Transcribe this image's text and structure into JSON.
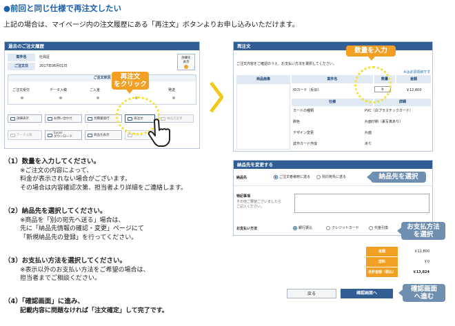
{
  "heading": "●前回と同じ仕様で再注文したい",
  "intro": "上記の場合は、マイページ内の注文履歴にある「再注文」ボタンよりお申し込みいただけます。",
  "history": {
    "title": "過去のご注文履歴",
    "rows": [
      {
        "label": "案件名",
        "value": "社員証"
      },
      {
        "label": "ご注文日",
        "value": "2017年06月01日"
      }
    ],
    "detail_button": "詳細を\n表示",
    "status_title": "ご注文状況",
    "steps": [
      "ご注文受付",
      "データ入稿",
      "ご入金",
      "",
      "発送"
    ],
    "buttons": [
      "詳細表示",
      "お問い合わせ",
      "見積書発行",
      "再注文",
      "納品先変更"
    ],
    "buttons2": [
      "データ入稿",
      "Excel\nダウンロード",
      "商品を表示",
      "ランク…"
    ]
  },
  "reorder": {
    "title": "再注文",
    "note": "ご注文内容をご確認のうえ、お支払い方法を選択してください。",
    "required_note": "※は必須項目です",
    "col_image": "商品画像",
    "col_name": "案件名",
    "col_qty": "数量",
    "col_amount": "金額",
    "product": "IDカード（反伝）",
    "qty_value": "b",
    "amount": "￥12,800",
    "spec_header": "仕様",
    "detail_header": "詳細",
    "specs": [
      {
        "k": "カードの種類",
        "v": "PVC（白プラスチックカード）"
      },
      {
        "k": "刷色",
        "v": "片面印刷（裏写真あり）"
      },
      {
        "k": "デザイン変更",
        "v": "片面"
      },
      {
        "k": "試作カード作成",
        "v": "あり"
      }
    ]
  },
  "delivery": {
    "title": "納品先を変更する",
    "label": "納品先",
    "opt1": "ご注文者様宛に送る",
    "opt2": "別の宛先に送る",
    "memo_label": "特記事項",
    "memo_hint": "その他ご要望ございましたら\nご記入ください。",
    "pay_label": "お支払い方法",
    "pay_opts": [
      "銀行振込",
      "クレジットカード",
      "代金引換"
    ]
  },
  "totals": [
    {
      "k": "金額",
      "v": "￥12,800"
    },
    {
      "k": "送料",
      "v": "￥0"
    },
    {
      "k": "合計金額（税込）",
      "v": "￥13,824"
    }
  ],
  "back_button": "戻る",
  "confirm_button": "確認画面へ",
  "callouts": {
    "reorder": "再注文\nをクリック",
    "qty": "数量を入力",
    "delivery": "納品先を選択",
    "payment": "お支払方法\nを選択",
    "confirm": "確認画面\nへ進む"
  },
  "instructions": [
    {
      "title": "（1）数量を入力してください。",
      "notes": [
        "※ご注文の内容によって、",
        "料金が表示されない場合がございます。",
        "その場合は内容確認次第、担当者より詳細をご連絡します。"
      ]
    },
    {
      "title": "（2）納品先を選択してください。",
      "notes": [
        "※商品を「別の宛先へ送る」場合は、",
        "先に「納品先情報の確認・変更」ページにて",
        "「新規納品先の登録」を行ってください。"
      ]
    },
    {
      "title": "（3）お支払い方法を選択してください。",
      "notes": [
        "※表示以外のお支払い方法をご希望の場合は、",
        "担当者までご相談ください。"
      ]
    },
    {
      "title": "（4）「確認画面」に進み、",
      "notes": [
        "記載内容に問題なければ「注文確定」して完了です。"
      ]
    }
  ],
  "colors": {
    "accent": "#1a5fa8",
    "orange": "#f2a024",
    "yellow": "#f3e236",
    "callout_blue": "#6e8fb0"
  }
}
